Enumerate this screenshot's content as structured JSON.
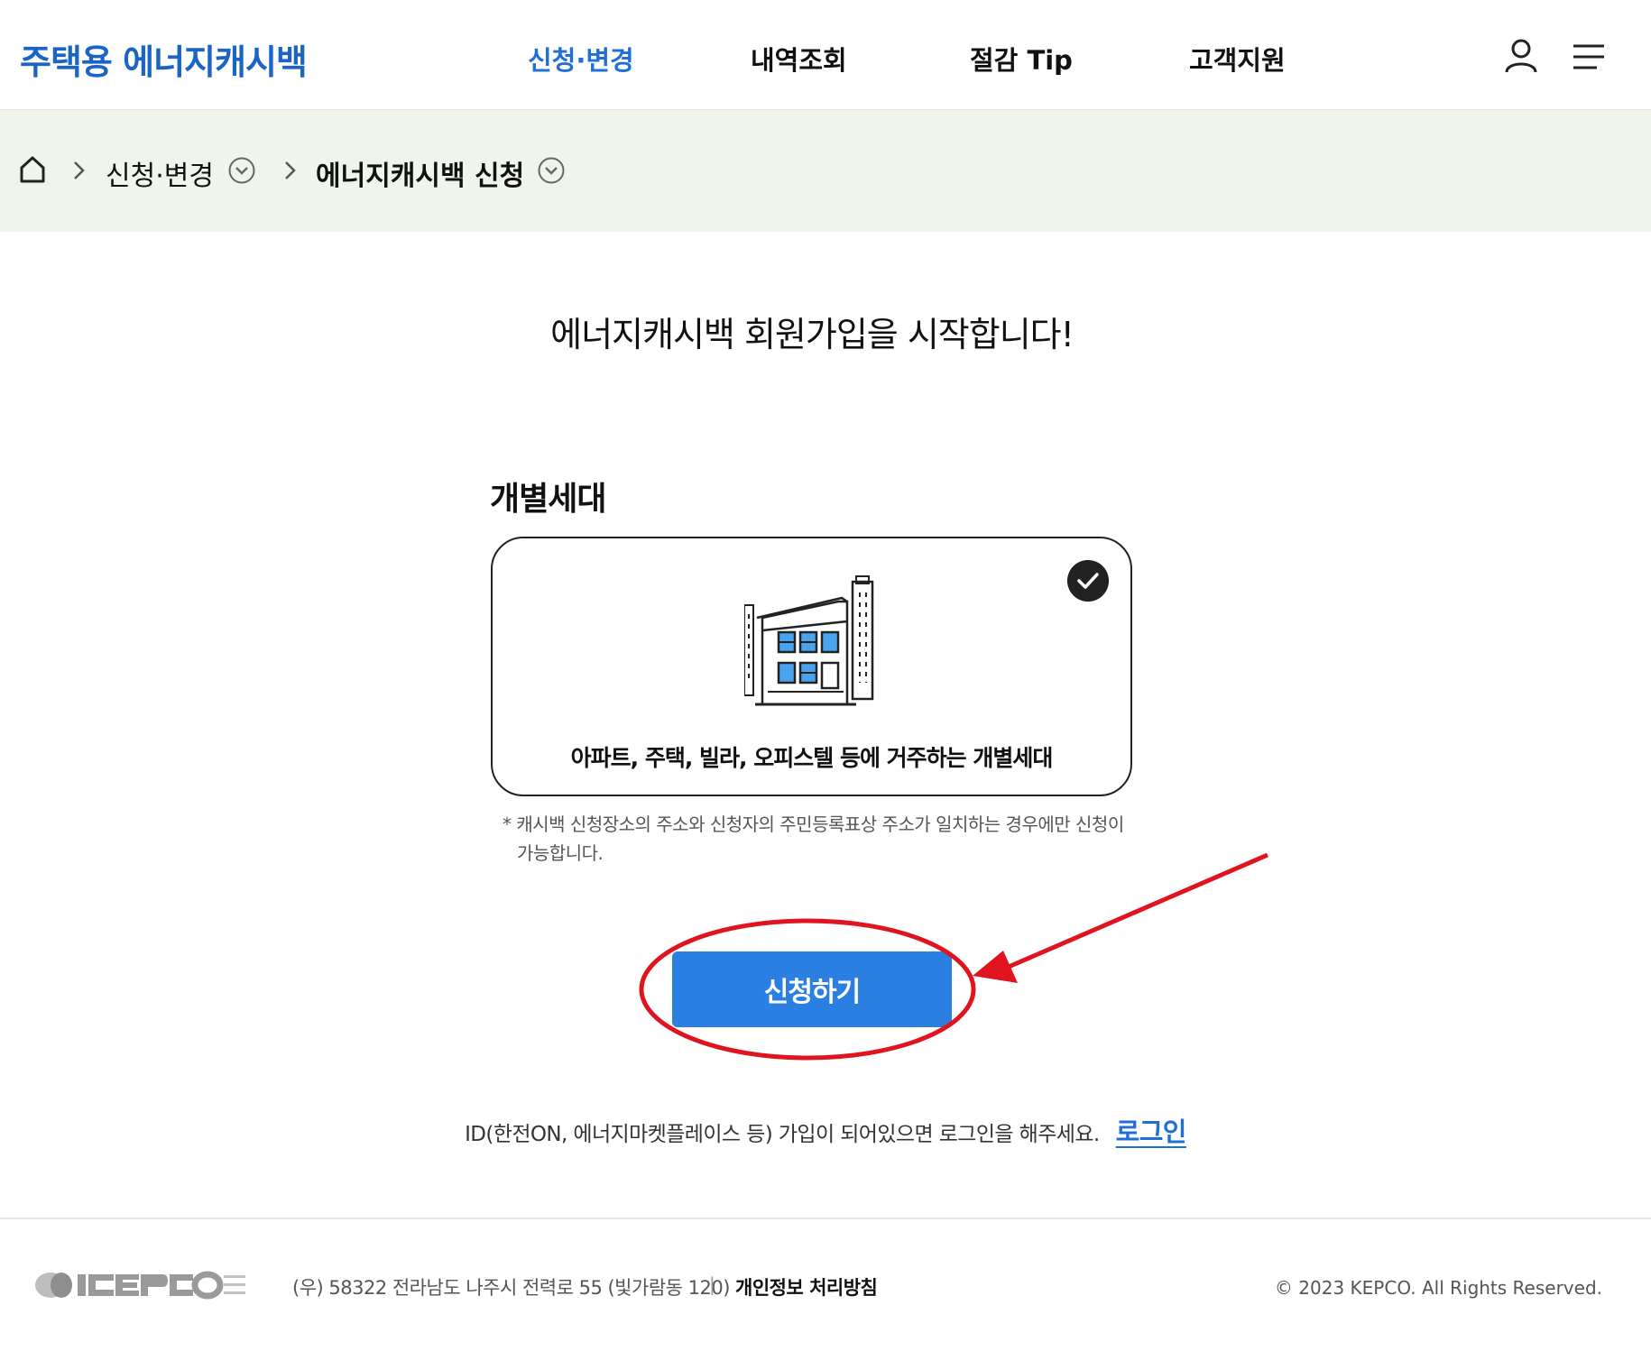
{
  "header": {
    "logo_text": "주택용 에너지캐시백",
    "nav": [
      "신청·변경",
      "내역조회",
      "절감 Tip",
      "고객지원"
    ],
    "active_nav": "신청·변경",
    "icons": [
      "user-icon",
      "hamburger-menu-icon"
    ]
  },
  "breadcrumb": {
    "home_icon": "home-icon",
    "items": [
      "신청·변경",
      "에너지캐시백 신청"
    ]
  },
  "main": {
    "headline": "에너지캐시백 회원가입을 시작합니다!",
    "section_title": "개별세대",
    "card": {
      "description": "아파트, 주택, 빌라, 오피스텔 등에 거주하는 개별세대",
      "selected": true,
      "icon": "building-icon"
    },
    "notice_line1": "* 캐시백 신청장소의 주소와 신청자의 주민등록표상 주소가 일치하는 경우에만 신청이",
    "notice_line2": "가능합니다.",
    "apply_button": "신청하기",
    "login_prompt": "ID(한전ON, 에너지마켓플레이스 등) 가입이 되어있으면 로그인을 해주세요.",
    "login_link": "로그인"
  },
  "footer": {
    "address": "(우) 58322 전라남도 나주시 전력로 55 (빛가람동 120)",
    "separator": "|",
    "privacy": "개인정보 처리방침",
    "copyright": "© 2023 KEPCO. All Rights Reserved."
  },
  "colors": {
    "brand_blue": "#1a63c7",
    "button_blue": "#2a7fe0",
    "breadcrumb_bg": "#f0f5ec",
    "annotation_red": "#e0141e"
  }
}
